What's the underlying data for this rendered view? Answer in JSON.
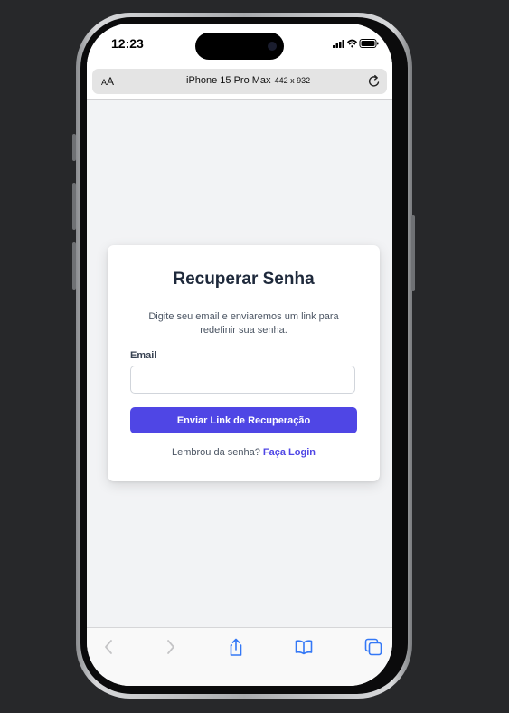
{
  "status_bar": {
    "time": "12:23"
  },
  "browser": {
    "text_size_label": "AA",
    "device_name": "iPhone 15 Pro Max",
    "device_size": "442 x 932"
  },
  "card": {
    "title": "Recuperar Senha",
    "description": "Digite seu email e enviaremos um link para redefinir sua senha.",
    "email_label": "Email",
    "email_value": "",
    "email_placeholder": "",
    "submit_label": "Enviar Link de Recuperação",
    "login_prompt": "Lembrou da senha?",
    "login_link": "Faça Login"
  },
  "toolbar": {
    "icons": [
      "back-icon",
      "forward-icon",
      "share-icon",
      "bookmarks-icon",
      "tabs-icon"
    ]
  },
  "colors": {
    "accent": "#4f46e5",
    "background": "#f2f3f5",
    "page_background": "#27282a"
  }
}
